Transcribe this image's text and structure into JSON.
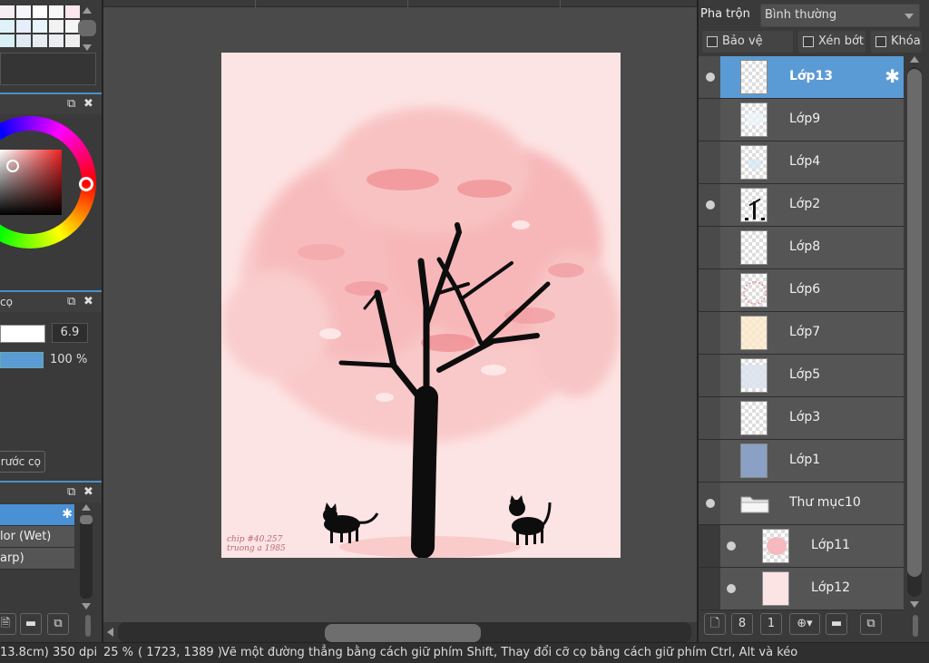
{
  "colors": {
    "accent": "#5b9bd5",
    "canvas_bg": "#fde4e4",
    "panel_bg": "#3a3a3a",
    "swatches": [
      "#f7eef4",
      "#f4f4fb",
      "#fdfdfd",
      "#f7f7f7",
      "#fbe6ee",
      "#dff2f8",
      "#e7eefb",
      "#eaf4fb",
      "#f2f2f2",
      "#f5f5f5",
      "#d6f0f3",
      "#dfeaf2",
      "#e6ecf1",
      "#ebedf0",
      "#eeeeee"
    ]
  },
  "left": {
    "brush_panel_label": "cọ",
    "brush_size": "6.9",
    "brush_opacity": "100 %",
    "prev_brush_label": "rước cọ",
    "brush_items": [
      {
        "label": "",
        "selected": true
      },
      {
        "label": "lor (Wet)"
      },
      {
        "label": "arp)"
      }
    ]
  },
  "layer_panel": {
    "blend_label": "Pha trộn",
    "blend_mode": "Bình thường",
    "protect_alpha": "Bảo vệ alpha",
    "clipping": "Xén bớt",
    "lock": "Khóa",
    "layers": [
      {
        "name": "Lớp13",
        "selected": true,
        "visible": true
      },
      {
        "name": "Lớp9",
        "visible": false
      },
      {
        "name": "Lớp4",
        "visible": false
      },
      {
        "name": "Lớp2",
        "visible": true
      },
      {
        "name": "Lớp8",
        "visible": false
      },
      {
        "name": "Lớp6",
        "visible": false
      },
      {
        "name": "Lớp7",
        "visible": false
      },
      {
        "name": "Lớp5",
        "visible": false
      },
      {
        "name": "Lớp3",
        "visible": false
      },
      {
        "name": "Lớp1",
        "visible": false
      },
      {
        "name": "Thư mục10",
        "folder": true,
        "visible": true
      },
      {
        "name": "Lớp11",
        "child": true,
        "visible": true
      },
      {
        "name": "Lớp12",
        "child": true,
        "visible": true
      }
    ]
  },
  "status": {
    "size": "13.8cm)",
    "dpi": "350 dpi",
    "zoom": "25 %",
    "coords": "( 1723, 1389 )",
    "hint": "Vẽ một đường thẳng bằng cách giữ phím Shift, Thay đổi cỡ cọ bằng cách giữ phím Ctrl, Alt và kéo"
  },
  "canvas": {
    "signature": "chip #40.257\ntruong a 1985"
  }
}
